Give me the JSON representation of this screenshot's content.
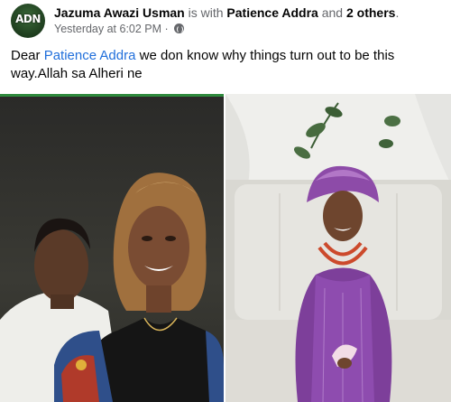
{
  "header": {
    "avatar_text": "ADN",
    "author_name": "Jazuma Awazi Usman",
    "connector": "is with",
    "tagged_name": "Patience Addra",
    "and_word": "and",
    "others": "2 others",
    "trailing": ".",
    "timestamp": "Yesterday at 6:02 PM",
    "separator": "·",
    "privacy_icon": "globe-icon"
  },
  "post": {
    "caption_prefix": "Dear",
    "mention": "Patience Addra",
    "caption_rest": "we don know why things turn out to be this way.Allah sa  Alheri ne"
  },
  "photos": [
    {
      "name": "couple-photo"
    },
    {
      "name": "bride-photo"
    }
  ],
  "colors": {
    "link": "#216fdb",
    "muted": "#65676b",
    "text": "#050505"
  }
}
